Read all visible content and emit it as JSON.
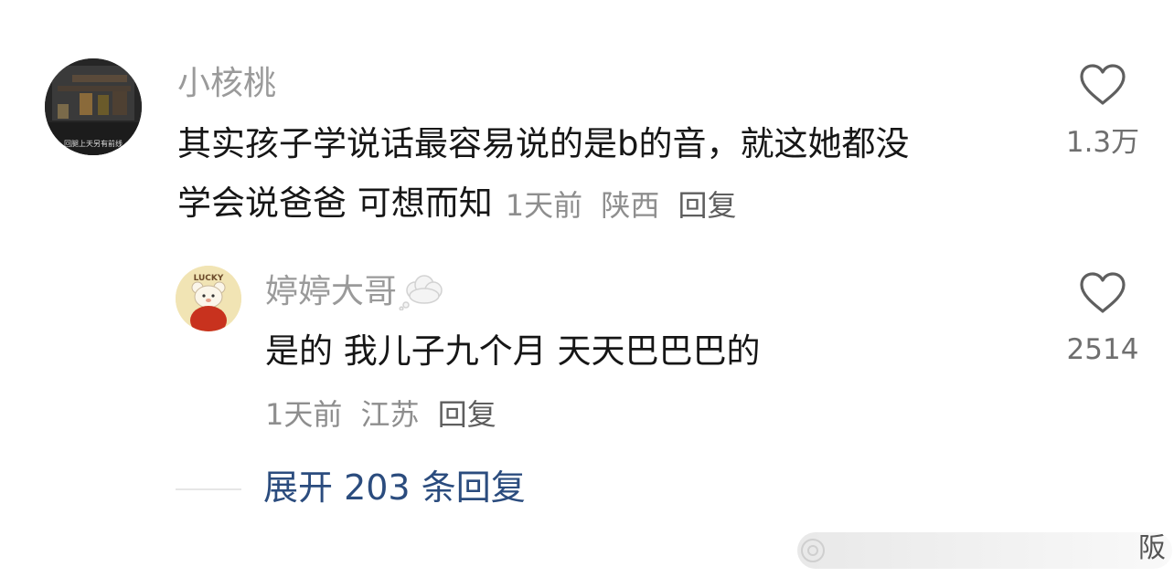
{
  "comments": [
    {
      "username": "小核桃",
      "avatar_caption": "回腿上天另有前线",
      "text_line1": "其实孩子学说话最容易说的是b的音，就这她都没",
      "text_line2": "学会说爸爸 可想而知",
      "time": "1天前",
      "location": "陕西",
      "reply_label": "回复",
      "likes": "1.3万",
      "icon": "heart-icon"
    },
    {
      "username": "婷婷大哥",
      "badge_icon": "thought-bubble-icon",
      "avatar_text": "LUCKY",
      "text": "是的 我儿子九个月 天天巴巴巴的",
      "time": "1天前",
      "location": "江苏",
      "reply_label": "回复",
      "likes": "2514",
      "icon": "heart-icon"
    }
  ],
  "expand_replies": "展开 203 条回复",
  "watermark": {
    "text": "阪"
  },
  "colors": {
    "username": "#9a9a9a",
    "comment_text": "#161616",
    "meta": "#8e8e8e",
    "link_blue": "#2b4c7e"
  }
}
